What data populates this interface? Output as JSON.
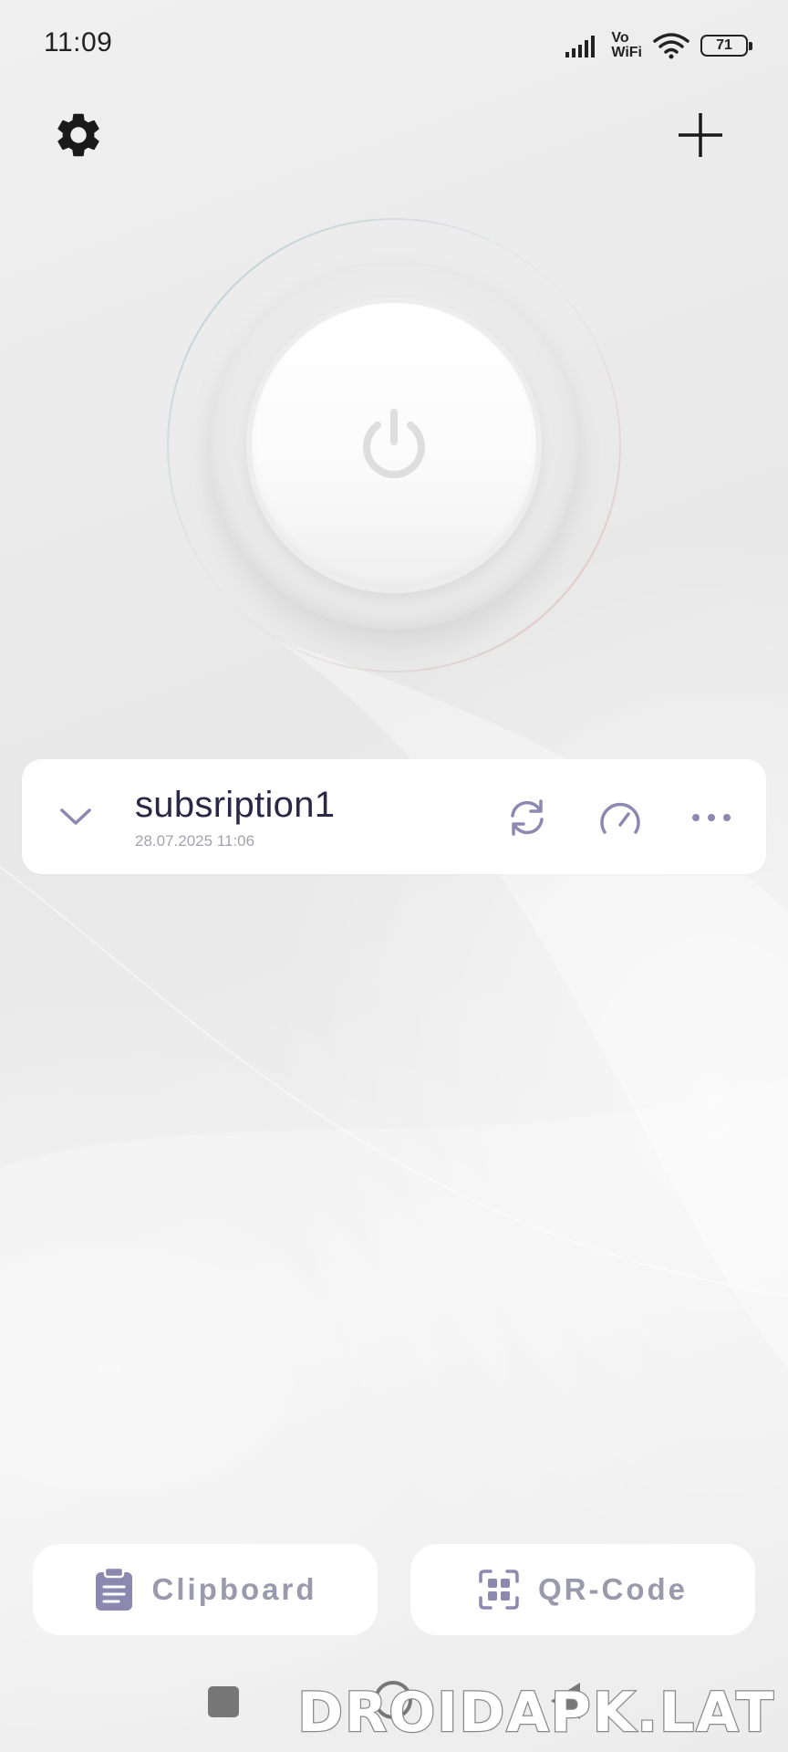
{
  "status_bar": {
    "time": "11:09",
    "vowifi_top": "Vo",
    "vowifi_bottom": "WiFi",
    "battery": "71",
    "icons": [
      "signal-icon",
      "vowifi-icon",
      "wifi-icon",
      "battery-icon"
    ]
  },
  "header": {
    "settings_icon": "gear-icon",
    "add_icon": "plus-icon"
  },
  "power": {
    "icon": "power-icon",
    "ring_colors": [
      "#a9c4cc",
      "#dcb7b7"
    ]
  },
  "subscription": {
    "name": "subsription1",
    "date": "28.07.2025 11:06",
    "icons": [
      "chevron-down-icon",
      "refresh-icon",
      "speedometer-icon",
      "more-horizontal-icon"
    ]
  },
  "bottom_actions": {
    "clipboard_label": "Clipboard",
    "qr_label": "QR-Code",
    "clipboard_icon": "clipboard-icon",
    "qr_icon": "qr-scan-icon"
  },
  "watermark": "DROIDAPK.LAT",
  "colors": {
    "accent": "#8c88b0",
    "text_primary": "#2a2747",
    "text_muted": "#a3a3ad",
    "background": "#ececec",
    "card": "#ffffff"
  }
}
